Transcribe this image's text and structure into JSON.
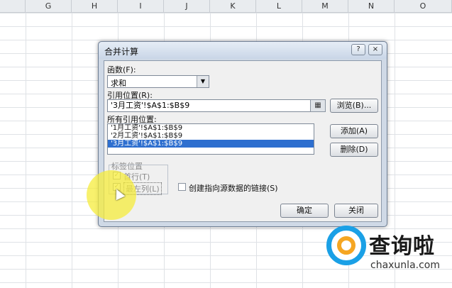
{
  "sheet": {
    "columns": [
      "G",
      "H",
      "I",
      "J",
      "K",
      "L",
      "M",
      "N",
      "O"
    ]
  },
  "dialog": {
    "title": "合并计算",
    "help_button": "?",
    "close_button": "×",
    "function_label": "函数(F):",
    "function_value": "求和",
    "ref_label": "引用位置(R):",
    "ref_value": "'3月工资'!$A$1:$B$9",
    "browse_label": "浏览(B)...",
    "all_refs_label": "所有引用位置:",
    "all_refs": [
      "'1月工资'!$A$1:$B$9",
      "'2月工资'!$A$1:$B$9",
      "'3月工资'!$A$1:$B$9"
    ],
    "add_label": "添加(A)",
    "delete_label": "删除(D)",
    "labels_group": "标签位置",
    "top_row_label": "首行(T)",
    "left_col_label": "最左列(L)",
    "create_links_label": "创建指向源数据的链接(S)",
    "ok_label": "确定",
    "close_label": "关闭"
  },
  "watermark": {
    "text": "查询啦",
    "sub": "chaxunla.com"
  }
}
